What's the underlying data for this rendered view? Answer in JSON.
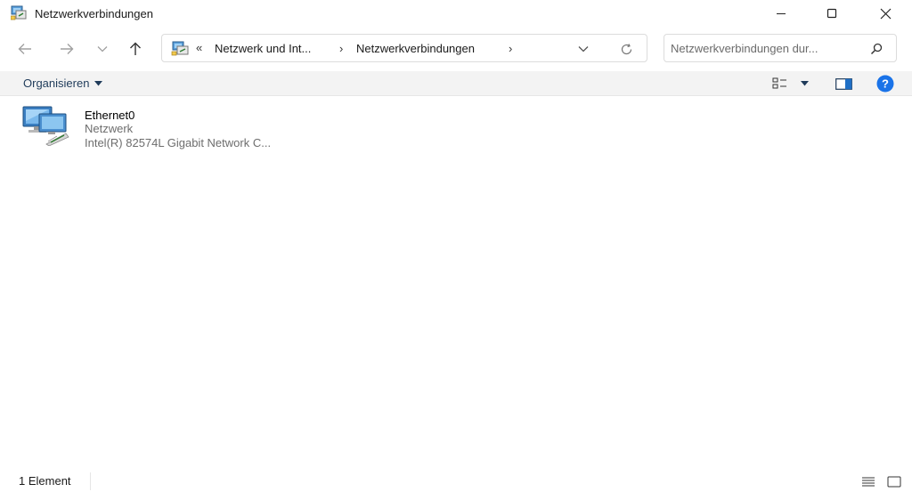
{
  "window": {
    "title": "Netzwerkverbindungen",
    "icons": {
      "app": "network-connections-icon",
      "minimize": "minimize-icon",
      "maximize": "maximize-icon",
      "close": "close-icon"
    }
  },
  "navigation": {
    "back_icon": "arrow-left-icon",
    "forward_icon": "arrow-right-icon",
    "recent_icon": "chevron-down-icon",
    "up_icon": "arrow-up-icon"
  },
  "address_bar": {
    "overflow": "«",
    "breadcrumbs": [
      "Netzwerk und Int...",
      "Netzwerkverbindungen"
    ],
    "separator": "›",
    "dropdown_icon": "chevron-down-icon",
    "refresh_icon": "refresh-icon"
  },
  "search": {
    "placeholder": "Netzwerkverbindungen dur...",
    "value": "",
    "icon": "search-icon"
  },
  "toolbar": {
    "organize_label": "Organisieren",
    "view_icon": "view-options-icon",
    "preview_pane_icon": "preview-pane-icon",
    "help_icon": "help-icon",
    "help_glyph": "?"
  },
  "items": [
    {
      "name": "Ethernet0",
      "status": "Netzwerk",
      "device": "Intel(R) 82574L Gigabit Network C...",
      "icon": "ethernet-adapter-icon"
    }
  ],
  "statusbar": {
    "count": "1 Element",
    "details_view_icon": "details-view-icon",
    "large_icons_view_icon": "large-icons-view-icon"
  },
  "colors": {
    "accent": "#1f3b5a",
    "help": "#1a73e8",
    "toolbar_bg": "#f3f3f3"
  }
}
